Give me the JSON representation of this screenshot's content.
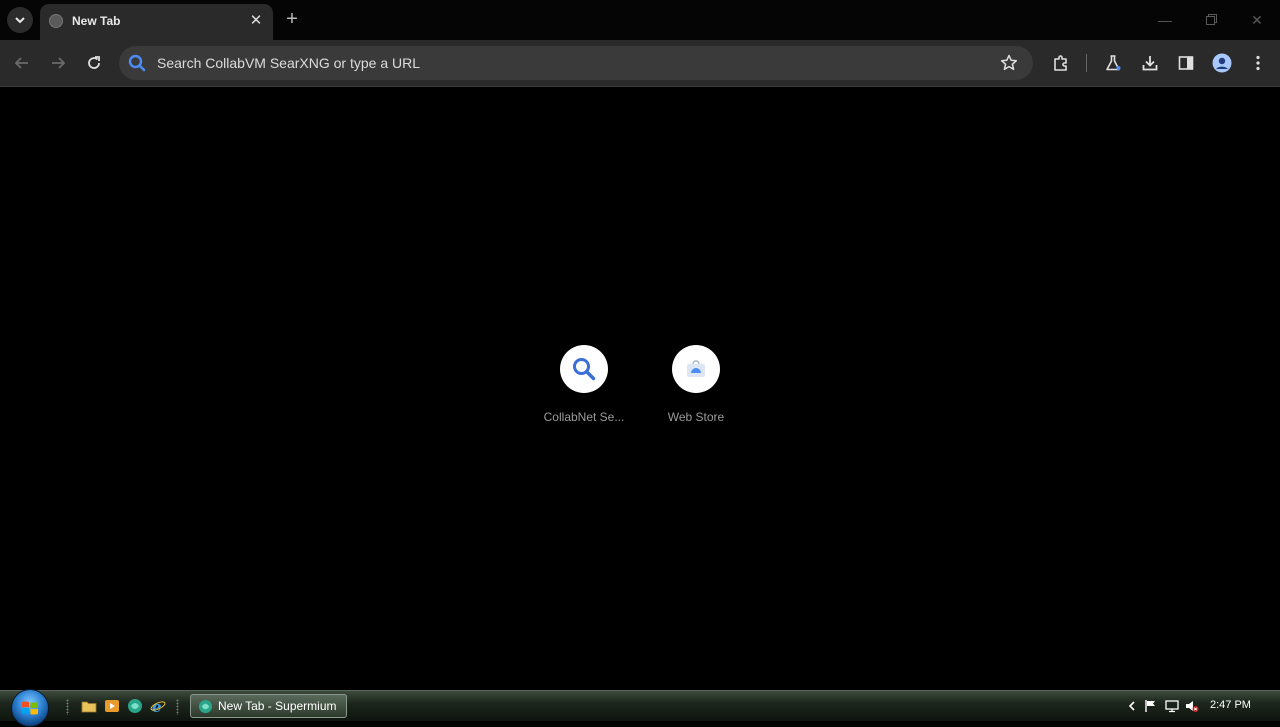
{
  "tab": {
    "title": "New Tab"
  },
  "omnibox": {
    "placeholder": "Search CollabVM SearXNG or type a URL"
  },
  "shortcuts": [
    {
      "label": "CollabNet Se..."
    },
    {
      "label": "Web Store"
    }
  ],
  "taskbar": {
    "task_label": "New Tab - Supermium",
    "clock": "2:47 PM"
  },
  "icons": {
    "tab_search": "chevron-down-icon",
    "tab_close": "close-icon",
    "new_tab": "plus-icon",
    "back": "arrow-left-icon",
    "forward": "arrow-right-icon",
    "reload": "reload-icon",
    "omnibox_search": "search-icon",
    "bookmark": "star-icon",
    "extensions": "puzzle-icon",
    "labs": "flask-icon",
    "downloads": "download-icon",
    "side_panel": "side-panel-icon",
    "profile": "profile-icon",
    "menu": "kebab-menu-icon"
  },
  "colors": {
    "accent_blue": "#4b8cf5",
    "toolbar_bg": "#2a2a2a",
    "omnibox_bg": "#3a3a3a",
    "page_bg": "#000000"
  }
}
